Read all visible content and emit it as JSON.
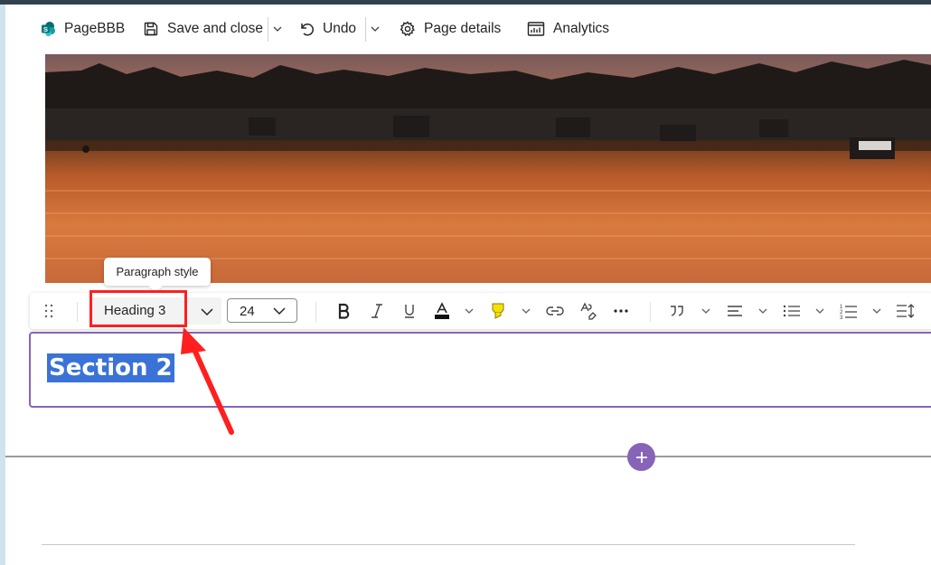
{
  "commandbar": {
    "page_name": "PageBBB",
    "save_label": "Save and close",
    "undo_label": "Undo",
    "details_label": "Page details",
    "analytics_label": "Analytics"
  },
  "hero": {
    "image_description": "sunset-over-lake-photo"
  },
  "tooltip": {
    "text": "Paragraph style"
  },
  "toolbar": {
    "paragraph_style": "Heading 3",
    "font_size": "24",
    "icons": [
      "gripper-icon",
      "chevron-down-icon",
      "bold-icon",
      "italic-icon",
      "underline-icon",
      "font-color-icon",
      "highlight-icon",
      "link-icon",
      "clear-format-icon",
      "more-icon",
      "quote-icon",
      "align-icon",
      "bullet-list-icon",
      "numbered-list-icon",
      "line-spacing-icon"
    ]
  },
  "editor": {
    "heading_text": "Section 2"
  },
  "colors": {
    "accent": "#8764b8",
    "selection": "#3a72d8",
    "annotation": "#ff1f1f",
    "highlight": "#f5e100"
  }
}
